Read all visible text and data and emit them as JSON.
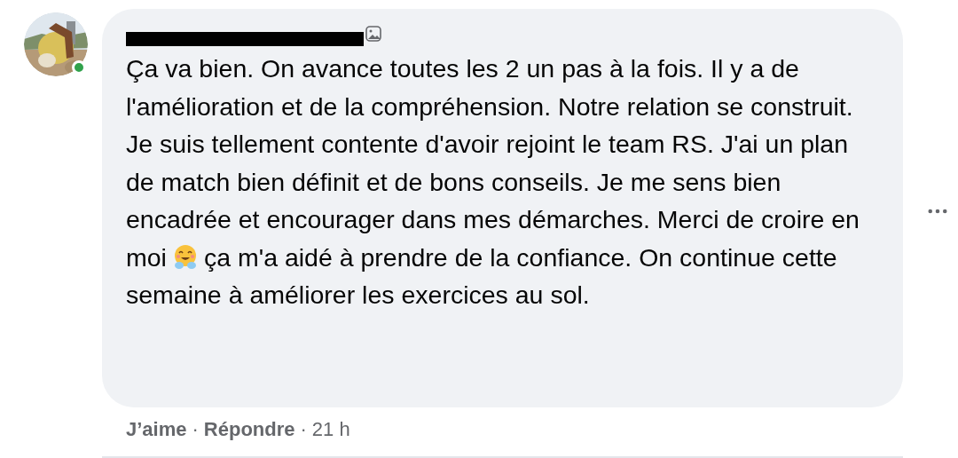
{
  "comment": {
    "author_online": true,
    "body": [
      {
        "kind": "text",
        "text": "Ça va bien. On avance toutes les 2 un pas à la fois. Il y a de l'amélioration et de la compréhension. Notre relation se construit. Je suis tellement contente d'avoir rejoint le team RS. J'ai un plan de match bien définit et de bons conseils. Je me sens bien encadrée et encourager dans mes démarches. Merci de croire en moi"
      },
      {
        "kind": "emoji"
      },
      {
        "kind": "text",
        "text": "ça m'a aidé à prendre de la confiance. On continue cette semaine à améliorer les exercices au sol."
      }
    ],
    "actions": [
      {
        "kind": "link",
        "text": "J’aime"
      },
      {
        "kind": "separator",
        "text": "·"
      },
      {
        "kind": "link",
        "text": "Répondre"
      },
      {
        "kind": "separator",
        "text": "·"
      },
      {
        "kind": "time",
        "text": "21 h"
      }
    ]
  }
}
